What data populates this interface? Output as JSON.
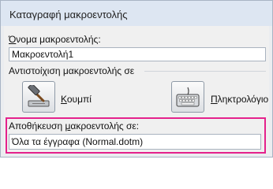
{
  "dialog": {
    "title": "Καταγραφή μακροεντολής",
    "macro_name_label_u": "Ό",
    "macro_name_label_rest": "νομα μακροεντολής:",
    "macro_name_value": "Μακροεντολή1",
    "assign_label": "Αντιστοίχιση μακροεντολής σε",
    "button_label_u": "Κ",
    "button_label_rest": "ουμπί",
    "keyboard_label_u": "Π",
    "keyboard_label_rest": "ληκτρολόγιο",
    "store_label_pre": "Αποθήκευση ",
    "store_label_u": "μ",
    "store_label_post": "ακροεντολής σε:",
    "store_value": "Όλα τα έγγραφα (Normal.dotm)",
    "highlight_color": "#e4228c"
  }
}
